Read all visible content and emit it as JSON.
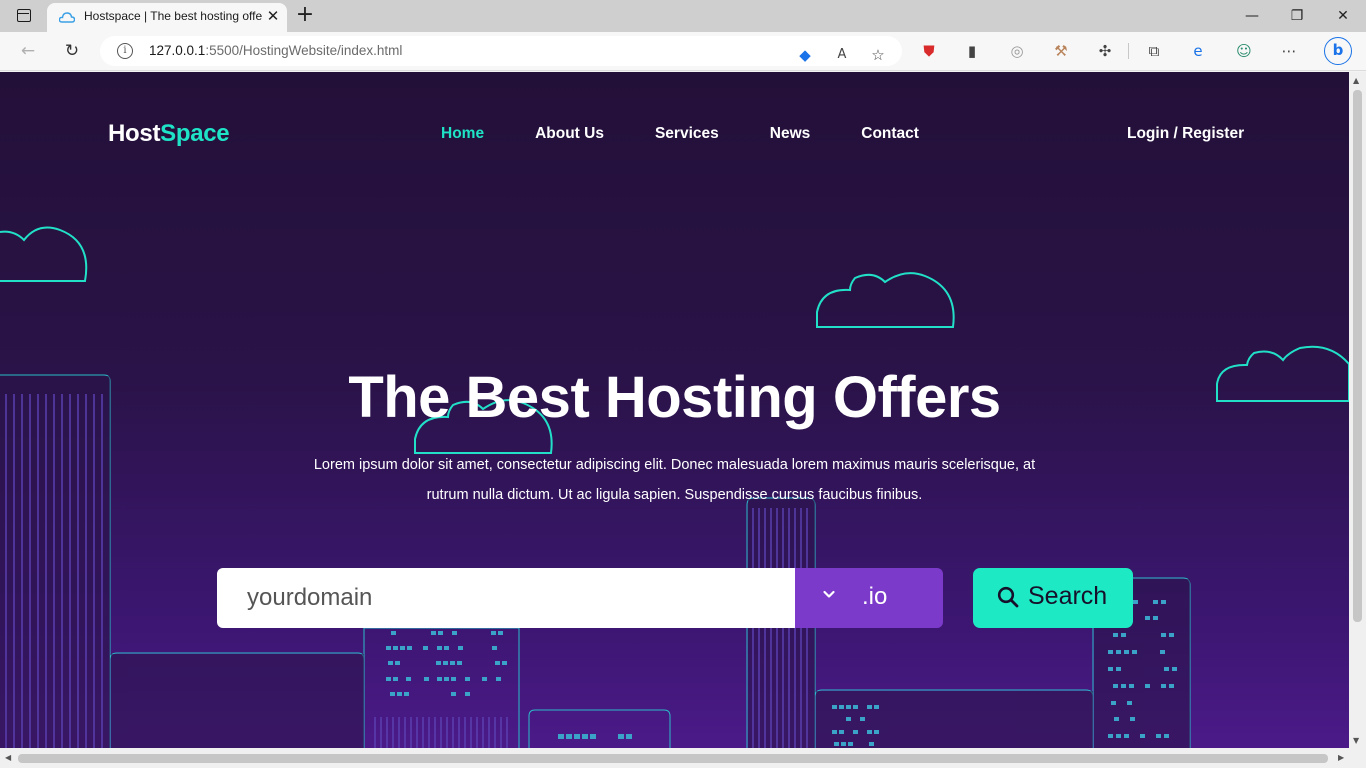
{
  "browser": {
    "tab_title": "Hostspace | The best hosting offers",
    "url_host": "127.0.0.1",
    "url_rest": ":5500/HostingWebsite/index.html"
  },
  "site": {
    "logo_part1": "Host",
    "logo_part2": "Space",
    "nav": [
      "Home",
      "About Us",
      "Services",
      "News",
      "Contact"
    ],
    "active_nav": "Home",
    "login": "Login / Register"
  },
  "hero": {
    "title": "The Best Hosting Offers",
    "description": "Lorem ipsum dolor sit amet, consectetur adipiscing elit. Donec malesuada lorem maximus mauris scelerisque, at rutrum nulla dictum. Ut ac ligula sapien. Suspendisse cursus faucibus finibus."
  },
  "search": {
    "placeholder": "yourdomain",
    "tld": ".io",
    "button": "Search"
  },
  "colors": {
    "accent": "#1fe3c6",
    "bg_dark": "#231038",
    "tld_bg": "#7b3ac9",
    "button_bg": "#1de9c4"
  }
}
